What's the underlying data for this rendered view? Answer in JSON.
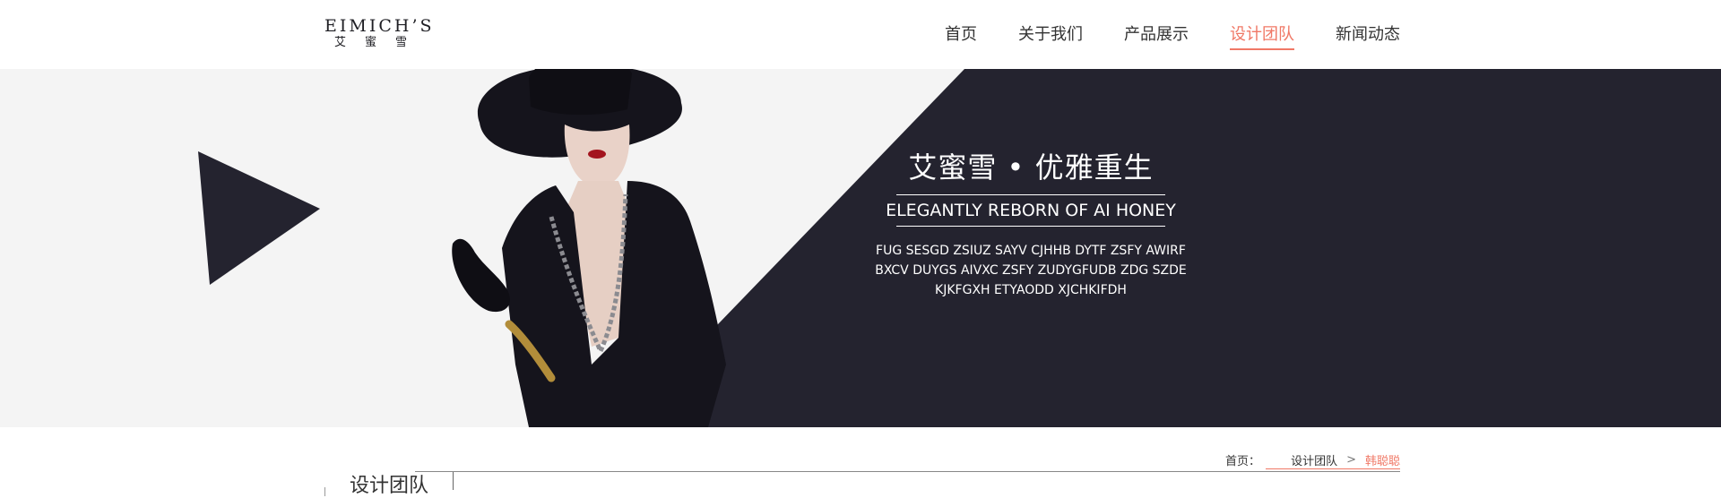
{
  "logo": {
    "en": "EIMICH’S",
    "cn": "艾蜜雪"
  },
  "nav": {
    "items": [
      {
        "label": "首页",
        "active": false
      },
      {
        "label": "关于我们",
        "active": false
      },
      {
        "label": "产品展示",
        "active": false
      },
      {
        "label": "设计团队",
        "active": true
      },
      {
        "label": "新闻动态",
        "active": false
      }
    ]
  },
  "banner": {
    "slogan": "艾蜜雪 • 优雅重生",
    "en_title": "ELEGANTLY REBORN OF AI HONEY",
    "desc_line1": "FUG SESGD ZSIUZ SAYV CJHHB DYTF ZSFY AWIRF",
    "desc_line2": "BXCV DUYGS AIVXC ZSFY ZUDYGFUDB ZDG SZDE",
    "desc_line3": "KJKFGXH ETYAODD XJCHKIFDH",
    "play_icon": "play-triangle-icon"
  },
  "breadcrumb": {
    "home": "首页：",
    "section": "设计团队",
    "sep": ">",
    "current": "韩聪聪"
  },
  "section": {
    "title": "设计团队"
  },
  "colors": {
    "accent": "#f07866",
    "dark": "#24232f",
    "light_bg": "#f4f4f4"
  }
}
